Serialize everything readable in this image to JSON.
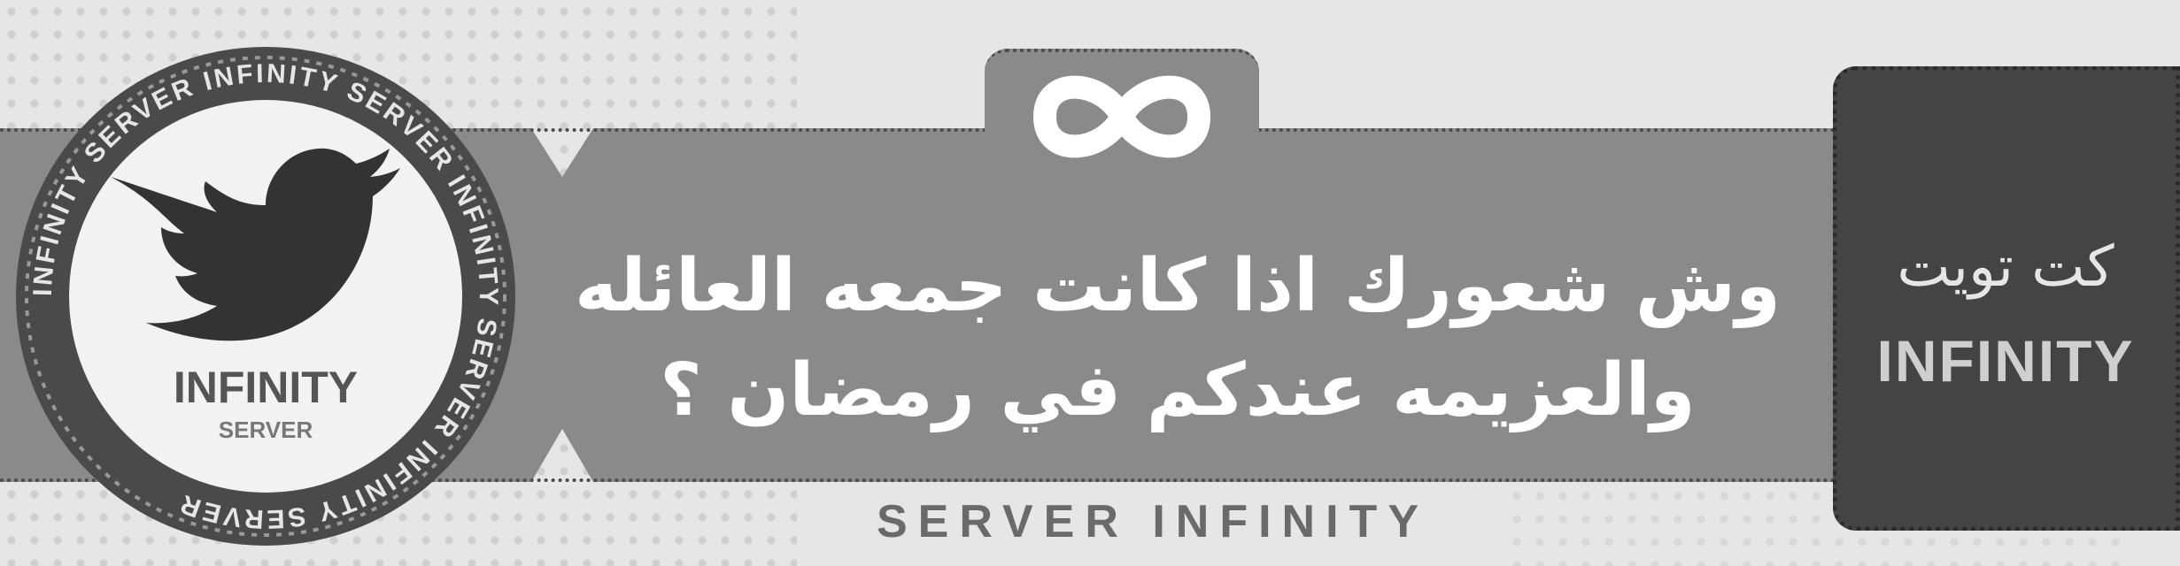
{
  "headline": {
    "line1": "وش شعورك اذا كانت جمعه العائله",
    "line2": "والعزيمه عندكم في رمضان ؟"
  },
  "footer_label": "SERVER INFINITY",
  "cta": {
    "arabic": "كت تويت",
    "english": "INFINITY"
  },
  "badge": {
    "title": "INFINITY",
    "subtitle": "SERVER",
    "ring_text": "INFINITY SERVER  INFINITY SERVER  INFINITY SERVER  INFINITY SERVER  "
  },
  "icons": {
    "badge_icon": "bird-icon",
    "top_icon": "infinity-icon"
  },
  "colors": {
    "band": "#8a8a8a",
    "dark_box": "#444444",
    "background": "#e6e6e6"
  }
}
